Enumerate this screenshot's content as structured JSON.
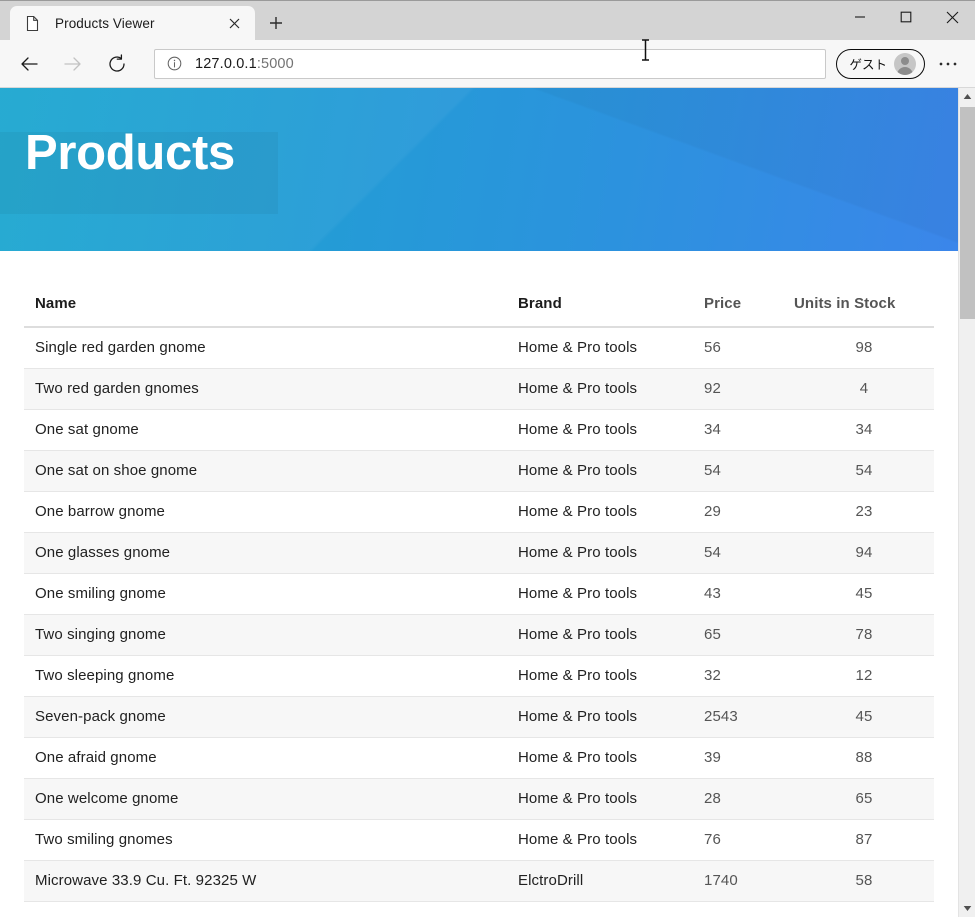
{
  "browser": {
    "tab": {
      "title": "Products Viewer",
      "favicon": "page-icon",
      "close": "×"
    },
    "new_tab_label": "+",
    "window_controls": {
      "minimize": "—",
      "maximize": "□",
      "close": "✕"
    },
    "toolbar": {
      "back": "←",
      "forward": "→",
      "reload": "↻",
      "url_host": "127.0.0.1",
      "url_port": ":5000",
      "url_full": "127.0.0.1:5000",
      "info_icon": "ⓘ",
      "profile_label": "ゲスト",
      "more_label": "…"
    }
  },
  "page": {
    "banner_title": "Products",
    "colors": {
      "banner_start": "#1da7d0",
      "banner_end": "#3b86ea",
      "row_stripe": "#f7f7f7",
      "value_text": "#555555"
    },
    "table": {
      "columns": [
        "Name",
        "Brand",
        "Price",
        "Units in Stock"
      ],
      "rows": [
        {
          "name": "Single red garden gnome",
          "brand": "Home & Pro tools",
          "price": "56",
          "units": "98"
        },
        {
          "name": "Two red garden gnomes",
          "brand": "Home & Pro tools",
          "price": "92",
          "units": "4"
        },
        {
          "name": "One sat gnome",
          "brand": "Home & Pro tools",
          "price": "34",
          "units": "34"
        },
        {
          "name": "One sat on shoe gnome",
          "brand": "Home & Pro tools",
          "price": "54",
          "units": "54"
        },
        {
          "name": "One barrow gnome",
          "brand": "Home & Pro tools",
          "price": "29",
          "units": "23"
        },
        {
          "name": "One glasses gnome",
          "brand": "Home & Pro tools",
          "price": "54",
          "units": "94"
        },
        {
          "name": "One smiling gnome",
          "brand": "Home & Pro tools",
          "price": "43",
          "units": "45"
        },
        {
          "name": "Two singing gnome",
          "brand": "Home & Pro tools",
          "price": "65",
          "units": "78"
        },
        {
          "name": "Two sleeping gnome",
          "brand": "Home & Pro tools",
          "price": "32",
          "units": "12"
        },
        {
          "name": "Seven-pack gnome",
          "brand": "Home & Pro tools",
          "price": "2543",
          "units": "45"
        },
        {
          "name": "One afraid gnome",
          "brand": "Home & Pro tools",
          "price": "39",
          "units": "88"
        },
        {
          "name": "One welcome gnome",
          "brand": "Home & Pro tools",
          "price": "28",
          "units": "65"
        },
        {
          "name": "Two smiling gnomes",
          "brand": "Home & Pro tools",
          "price": "76",
          "units": "87"
        },
        {
          "name": "Microwave 33.9 Cu. Ft. 92325 W",
          "brand": "ElctroDrill",
          "price": "1740",
          "units": "58"
        }
      ]
    }
  },
  "scrollbar": {
    "up_arrow": "▲",
    "down_arrow": "▼"
  }
}
